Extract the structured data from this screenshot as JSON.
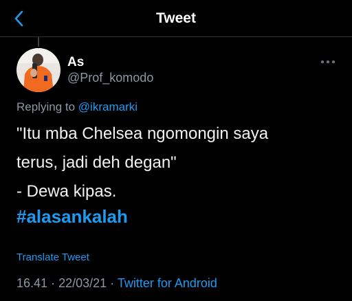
{
  "header": {
    "title": "Tweet",
    "back_icon": "chevron-left-icon"
  },
  "colors": {
    "background": "#000000",
    "accent": "#1d9bf0",
    "secondary_text": "#8b98a5",
    "primary_text": "#ffffff"
  },
  "tweet": {
    "author": {
      "display_name": "As",
      "handle": "@Prof_komodo",
      "avatar_icon": "profile-photo"
    },
    "more_icon": "ellipsis-icon",
    "reply": {
      "prefix": "Replying to",
      "mention": "@ikramarki"
    },
    "text_lines": [
      "\"Itu mba Chelsea ngomongin saya",
      "terus, jadi deh degan\"",
      "- Dewa kipas."
    ],
    "hashtag": "#alasankalah",
    "translate_label": "Translate Tweet",
    "time": "16.41",
    "separator": "·",
    "date": "22/03/21",
    "source": "Twitter for Android"
  }
}
